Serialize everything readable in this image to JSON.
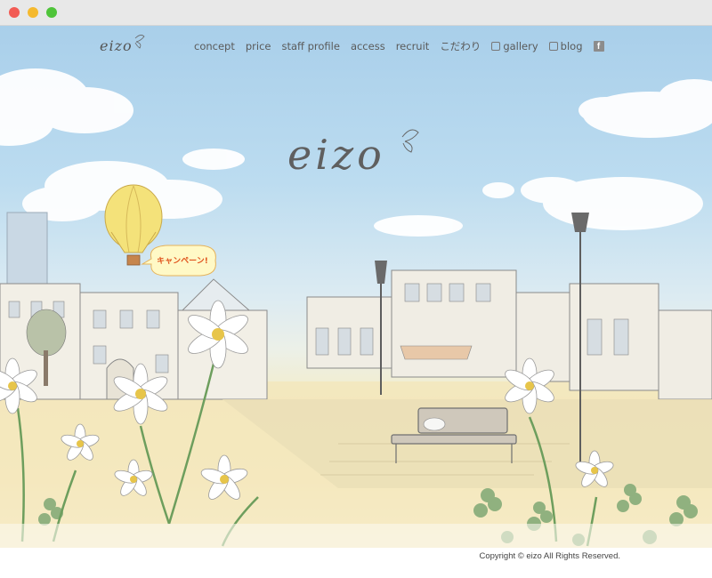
{
  "brand": {
    "logo": "eizo",
    "hero_logo": "eizo"
  },
  "nav": {
    "items": [
      {
        "label": "concept"
      },
      {
        "label": "price"
      },
      {
        "label": "staff profile"
      },
      {
        "label": "access"
      },
      {
        "label": "recruit"
      },
      {
        "label": "こだわり"
      },
      {
        "label": "gallery",
        "icon": "external-icon"
      },
      {
        "label": "blog",
        "icon": "external-icon"
      }
    ],
    "facebook_label": "f"
  },
  "campaign": {
    "label": "キャンペーン!"
  },
  "footer": {
    "copyright": "Copyright © eizo All Rights Reserved."
  },
  "colors": {
    "sky": "#a9cfea",
    "ground": "#f3ecc8",
    "campaign_text": "#e0541e",
    "balloon": "#f4e27a"
  }
}
